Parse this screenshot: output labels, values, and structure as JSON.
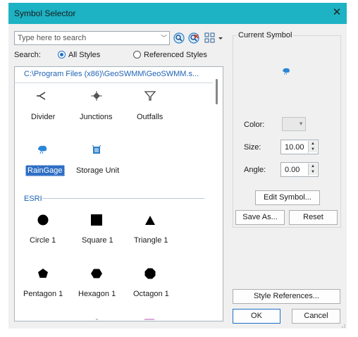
{
  "window": {
    "title": "Symbol Selector"
  },
  "search": {
    "placeholder": "Type here to search",
    "label": "Search:",
    "option_all": "All Styles",
    "option_referenced": "Referenced Styles",
    "selected": "All Styles"
  },
  "style_path": "C:\\Program Files (x86)\\GeoSWMM\\GeoSWMM.s...",
  "geoswmm_symbols": [
    {
      "label": "Divider",
      "icon": "divider-icon"
    },
    {
      "label": "Junctions",
      "icon": "junction-icon"
    },
    {
      "label": "Outfalls",
      "icon": "outfall-icon"
    },
    {
      "label": "RainGage",
      "icon": "raingage-icon",
      "selected": true
    },
    {
      "label": "Storage Unit",
      "icon": "storage-unit-icon"
    }
  ],
  "esri": {
    "heading": "ESRI",
    "symbols": [
      {
        "label": "Circle 1",
        "icon": "circle-icon"
      },
      {
        "label": "Square 1",
        "icon": "square-icon"
      },
      {
        "label": "Triangle 1",
        "icon": "triangle-icon"
      },
      {
        "label": "Pentagon 1",
        "icon": "pentagon-icon"
      },
      {
        "label": "Hexagon 1",
        "icon": "hexagon-icon"
      },
      {
        "label": "Octagon 1",
        "icon": "octagon-icon"
      }
    ]
  },
  "current_symbol": {
    "heading": "Current Symbol",
    "color_label": "Color:",
    "size_label": "Size:",
    "size_value": "10.00",
    "angle_label": "Angle:",
    "angle_value": "0.00",
    "edit_button": "Edit Symbol...",
    "save_as_button": "Save As...",
    "reset_button": "Reset"
  },
  "footer": {
    "style_references_button": "Style References...",
    "ok_button": "OK",
    "cancel_button": "Cancel"
  },
  "colors": {
    "titlebar": "#1db2c4",
    "accent": "#1e70c8",
    "path_text": "#1e63b5",
    "raingage_icon": "#2a86d6",
    "storage_icon": "#2a7fc8"
  }
}
